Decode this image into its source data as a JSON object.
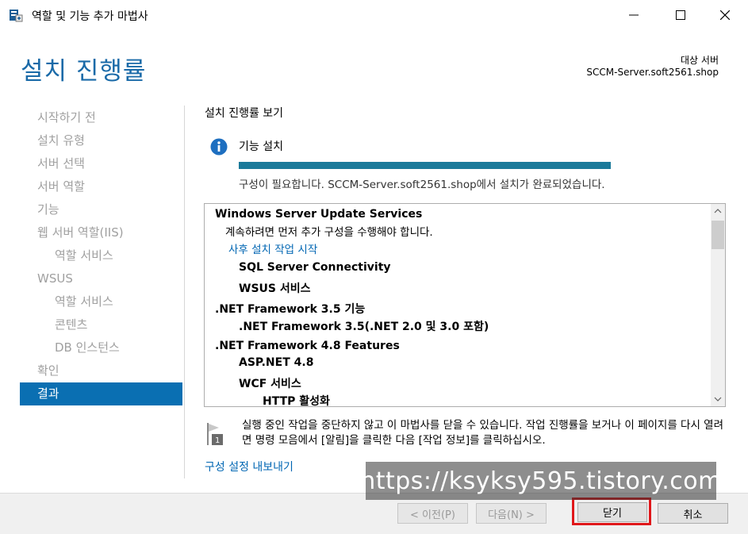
{
  "window": {
    "title": "역할 및 기능 추가 마법사",
    "icon": "server-manager-icon"
  },
  "header": {
    "title": "설치 진행률",
    "target_label": "대상 서버",
    "target_server": "SCCM-Server.soft2561.shop"
  },
  "nav": {
    "items": [
      {
        "label": "시작하기 전"
      },
      {
        "label": "설치 유형"
      },
      {
        "label": "서버 선택"
      },
      {
        "label": "서버 역할"
      },
      {
        "label": "기능"
      },
      {
        "label": "웹 서버 역할(IIS)"
      },
      {
        "label": "역할 서비스"
      },
      {
        "label": "WSUS"
      },
      {
        "label": "역할 서비스"
      },
      {
        "label": "콘텐츠"
      },
      {
        "label": "DB 인스턴스"
      },
      {
        "label": "확인"
      },
      {
        "label": "결과"
      }
    ]
  },
  "main": {
    "section_title": "설치 진행률 보기",
    "feature_title": "기능 설치",
    "progress": 1.0,
    "status": "구성이 필요합니다. SCCM-Server.soft2561.shop에서 설치가 완료되었습니다.",
    "results": [
      {
        "text": "Windows Server Update Services"
      },
      {
        "text": "계속하려면 먼저 추가 구성을 수행해야 합니다."
      },
      {
        "text": "사후 설치 작업 시작"
      },
      {
        "text": "SQL Server Connectivity"
      },
      {
        "text": "WSUS 서비스"
      },
      {
        "text": ".NET Framework 3.5 기능"
      },
      {
        "text": ".NET Framework 3.5(.NET 2.0 및 3.0 포함)"
      },
      {
        "text": ".NET Framework 4.8 Features"
      },
      {
        "text": "ASP.NET 4.8"
      },
      {
        "text": "WCF 서비스"
      },
      {
        "text": "HTTP 활성화"
      }
    ],
    "note": "실행 중인 작업을 중단하지 않고 이 마법사를 닫을 수 있습니다. 작업 진행률을 보거나 이 페이지를 다시 열려면 명령 모음에서 [알림]을 클릭한 다음 [작업 정보]를 클릭하십시오.",
    "export_link": "구성 설정 내보내기"
  },
  "footer": {
    "prev": "< 이전(P)",
    "next": "다음(N) >",
    "close": "닫기",
    "cancel": "취소"
  },
  "watermark": "https://ksyksy595.tistory.com",
  "colors": {
    "accent": "#0a6fb2",
    "title": "#1a6aa8",
    "progress": "#1b7a9a",
    "highlight": "#e0181b"
  }
}
